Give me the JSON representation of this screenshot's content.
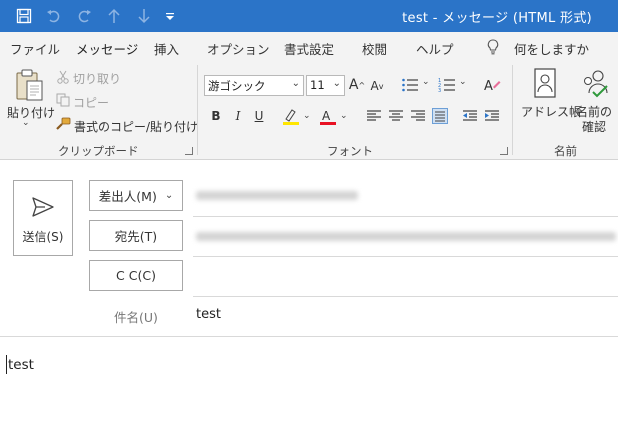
{
  "window": {
    "title": "test  -  メッセージ (HTML 形式)"
  },
  "colors": {
    "titlebar": "#2b74c8",
    "ribbon": "#f3f3f3",
    "accent": "#2b74c8"
  },
  "quick_access": [
    "save-icon",
    "undo-icon",
    "redo-icon",
    "up-arrow-icon",
    "down-arrow-icon",
    "customize-icon"
  ],
  "tabs": [
    {
      "label": "ファイル"
    },
    {
      "label": "メッセージ",
      "active": true
    },
    {
      "label": "挿入"
    },
    {
      "label": "オプション"
    },
    {
      "label": "書式設定"
    },
    {
      "label": "校閲"
    },
    {
      "label": "ヘルプ"
    }
  ],
  "tell_me": {
    "label": "何をしますか"
  },
  "ribbon": {
    "clipboard": {
      "paste_label": "貼り付け",
      "cut_label": "切り取り",
      "copy_label": "コピー",
      "format_painter_label": "書式のコピー/貼り付け",
      "group_label": "クリップボード"
    },
    "font": {
      "font_name": "游ゴシック",
      "font_size": "11",
      "group_label": "フォント"
    },
    "names": {
      "address_book_label": "アドレス帳",
      "check_names_label_1": "名前の",
      "check_names_label_2": "確認",
      "group_label": "名前"
    }
  },
  "compose": {
    "send_label": "送信(S)",
    "from_label": "差出人(M)",
    "to_label": "宛先(T)",
    "cc_label": "C C(C)",
    "subject_label": "件名(U)",
    "subject_value": "test",
    "body_text": "test"
  }
}
